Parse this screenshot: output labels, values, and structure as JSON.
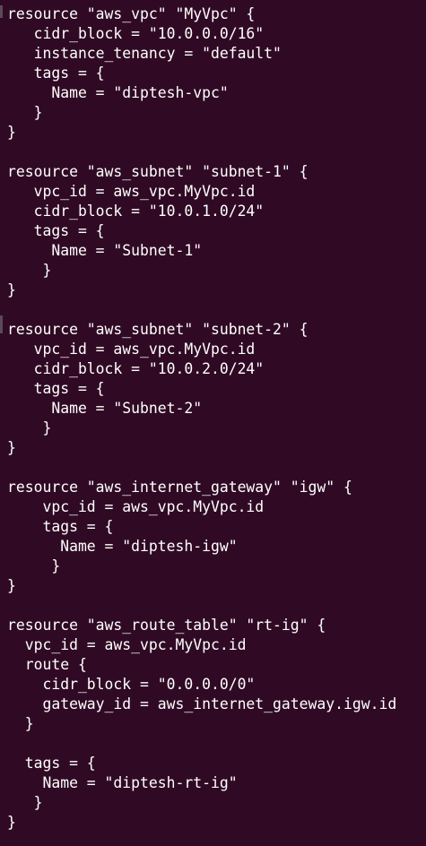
{
  "terminal": {
    "background": "#300a24",
    "foreground": "#ffffff",
    "lines": [
      "resource \"aws_vpc\" \"MyVpc\" {",
      "   cidr_block = \"10.0.0.0/16\"",
      "   instance_tenancy = \"default\"",
      "   tags = {",
      "     Name = \"diptesh-vpc\"",
      "   }",
      "}",
      "",
      "resource \"aws_subnet\" \"subnet-1\" {",
      "   vpc_id = aws_vpc.MyVpc.id",
      "   cidr_block = \"10.0.1.0/24\"",
      "   tags = {",
      "     Name = \"Subnet-1\"",
      "    }",
      "}",
      "",
      "resource \"aws_subnet\" \"subnet-2\" {",
      "   vpc_id = aws_vpc.MyVpc.id",
      "   cidr_block = \"10.0.2.0/24\"",
      "   tags = {",
      "     Name = \"Subnet-2\"",
      "    }",
      "}",
      "",
      "resource \"aws_internet_gateway\" \"igw\" {",
      "    vpc_id = aws_vpc.MyVpc.id",
      "    tags = {",
      "      Name = \"diptesh-igw\"",
      "     }",
      "}",
      "",
      "resource \"aws_route_table\" \"rt-ig\" {",
      "  vpc_id = aws_vpc.MyVpc.id",
      "  route {",
      "    cidr_block = \"0.0.0.0/0\"",
      "    gateway_id = aws_internet_gateway.igw.id",
      "  }",
      "",
      "  tags = {",
      "    Name = \"diptesh-rt-ig\"",
      "   }",
      "}"
    ]
  }
}
